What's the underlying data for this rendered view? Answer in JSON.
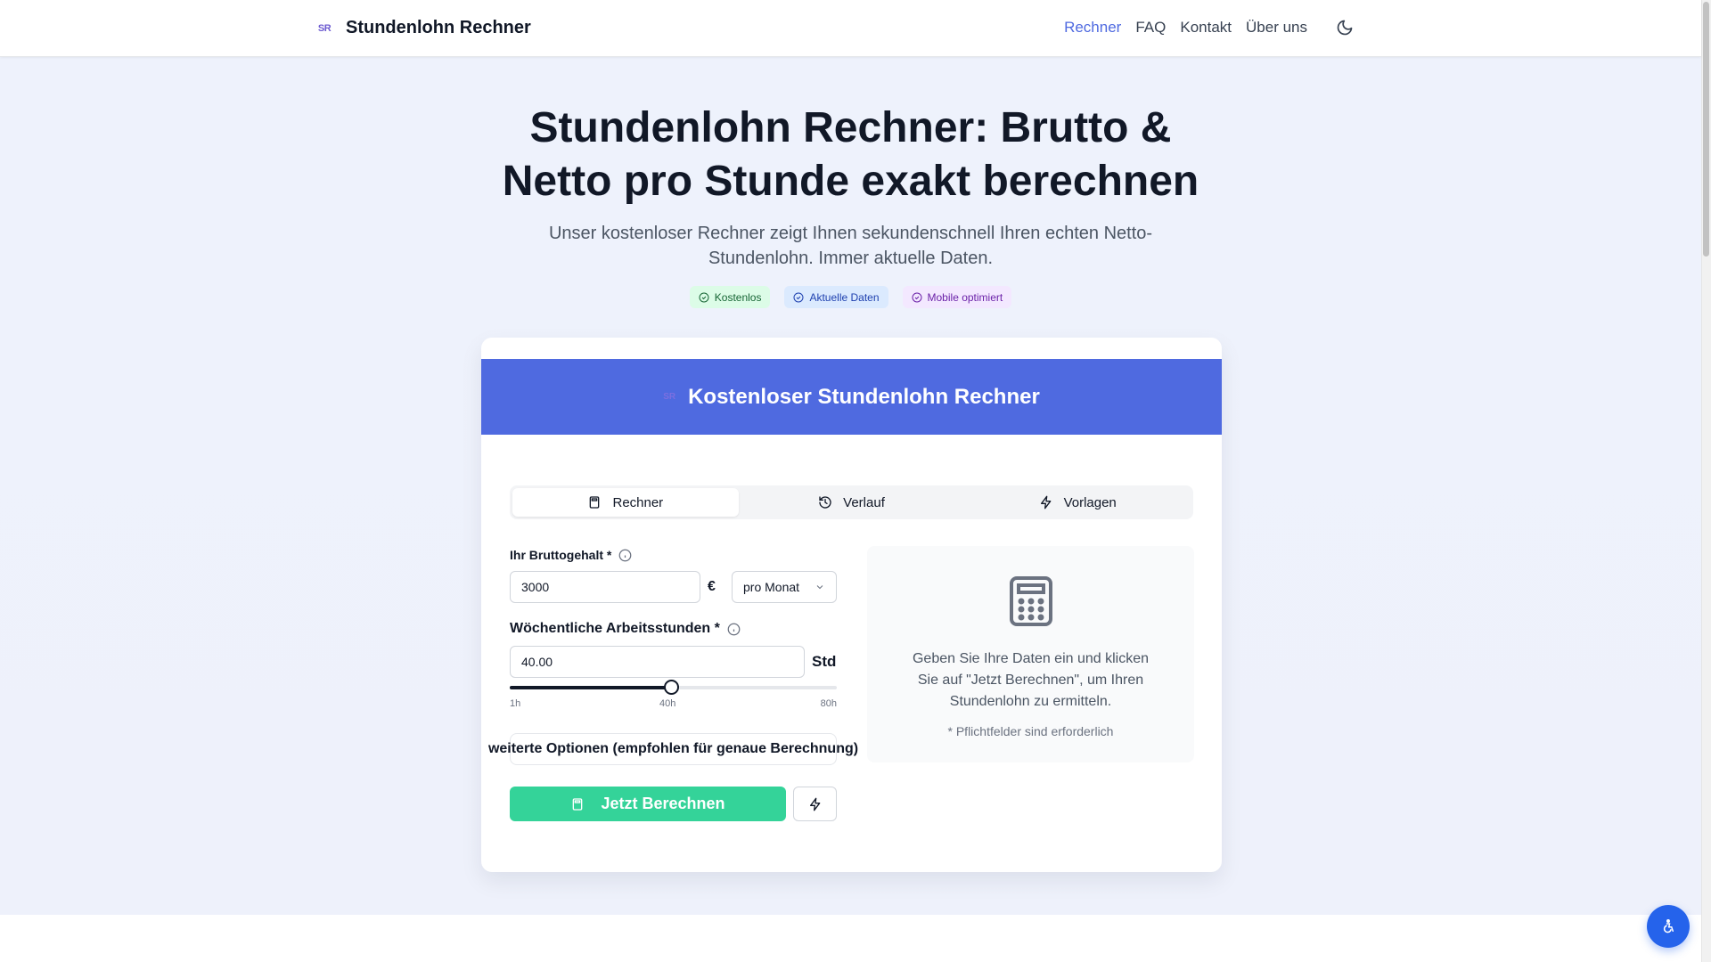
{
  "header": {
    "logo_text": "SR",
    "brand": "Stundenlohn Rechner",
    "nav": [
      {
        "label": "Rechner",
        "active": true
      },
      {
        "label": "FAQ",
        "active": false
      },
      {
        "label": "Kontakt",
        "active": false
      },
      {
        "label": "Über uns",
        "active": false
      }
    ],
    "theme_toggle_icon": "moon-icon"
  },
  "hero": {
    "title_line1": "Stundenlohn Rechner: Brutto &",
    "title_line2": "Netto pro Stunde exakt berechnen",
    "subtitle_line1": "Unser kostenloser Rechner zeigt Ihnen sekundenschnell Ihren echten Netto-",
    "subtitle_line2": "Stundenlohn. Immer aktuelle Daten.",
    "badges": [
      {
        "label": "Kostenlos",
        "color": "#166534"
      },
      {
        "label": "Aktuelle Daten",
        "color": "#1e40af"
      },
      {
        "label": "Mobile optimiert",
        "color": "#6b21a8"
      }
    ]
  },
  "card": {
    "title": "Kostenloser Stundenlohn Rechner",
    "header_color": "#4f6ae0",
    "tabs": [
      {
        "label": "Rechner",
        "icon": "calculator-icon",
        "active": true
      },
      {
        "label": "Verlauf",
        "icon": "history-icon",
        "active": false
      },
      {
        "label": "Vorlagen",
        "icon": "lightning-icon",
        "active": false
      }
    ],
    "gross": {
      "label": "Ihr Bruttogehalt *",
      "value": "3000",
      "currency": "€",
      "period": "pro Monat"
    },
    "hours": {
      "label": "Wöchentliche Arbeitsstunden *",
      "value": "40.00",
      "unit": "Std",
      "slider_min": 1,
      "slider_max": 80,
      "slider_value": 40,
      "tick_min": "1h",
      "tick_mid": "40h",
      "tick_max": "80h"
    },
    "options_label": "weiterte Optionen (empfohlen für genaue Berechnung)",
    "calculate_label": "Jetzt Berechnen",
    "calculate_color": "#34d399",
    "result": {
      "line1": "Geben Sie Ihre Daten ein und klicken",
      "line2": "Sie auf \"Jetzt Berechnen\", um Ihren",
      "line3": "Stundenlohn zu ermitteln.",
      "note": "* Pflichtfelder sind erforderlich"
    }
  },
  "accessibility_button_color": "#2563eb"
}
